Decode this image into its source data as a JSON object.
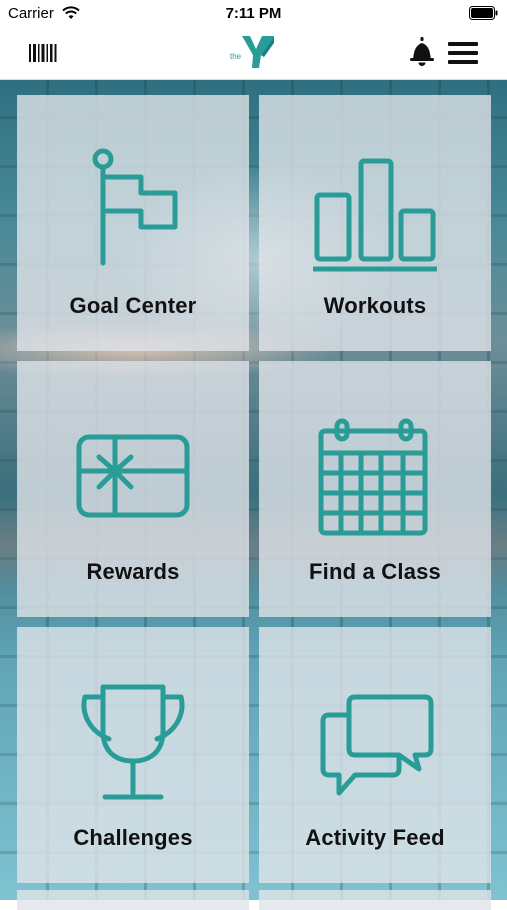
{
  "status_bar": {
    "carrier": "Carrier",
    "time": "7:11 PM",
    "wifi_icon": "wifi-icon",
    "battery_icon": "battery-icon"
  },
  "nav": {
    "left_icon": "barcode-icon",
    "logo_text": "the",
    "right_icons": [
      "bell-icon",
      "menu-icon"
    ]
  },
  "colors": {
    "accent": "#2a9c98",
    "tile_bg": "rgba(224,228,232,0.80)",
    "text": "#111111"
  },
  "tiles": [
    {
      "label": "Goal Center",
      "icon": "flag-icon"
    },
    {
      "label": "Workouts",
      "icon": "bar-chart-icon"
    },
    {
      "label": "Rewards",
      "icon": "gift-card-icon"
    },
    {
      "label": "Find a Class",
      "icon": "calendar-icon"
    },
    {
      "label": "Challenges",
      "icon": "trophy-icon"
    },
    {
      "label": "Activity Feed",
      "icon": "chat-bubbles-icon"
    }
  ]
}
